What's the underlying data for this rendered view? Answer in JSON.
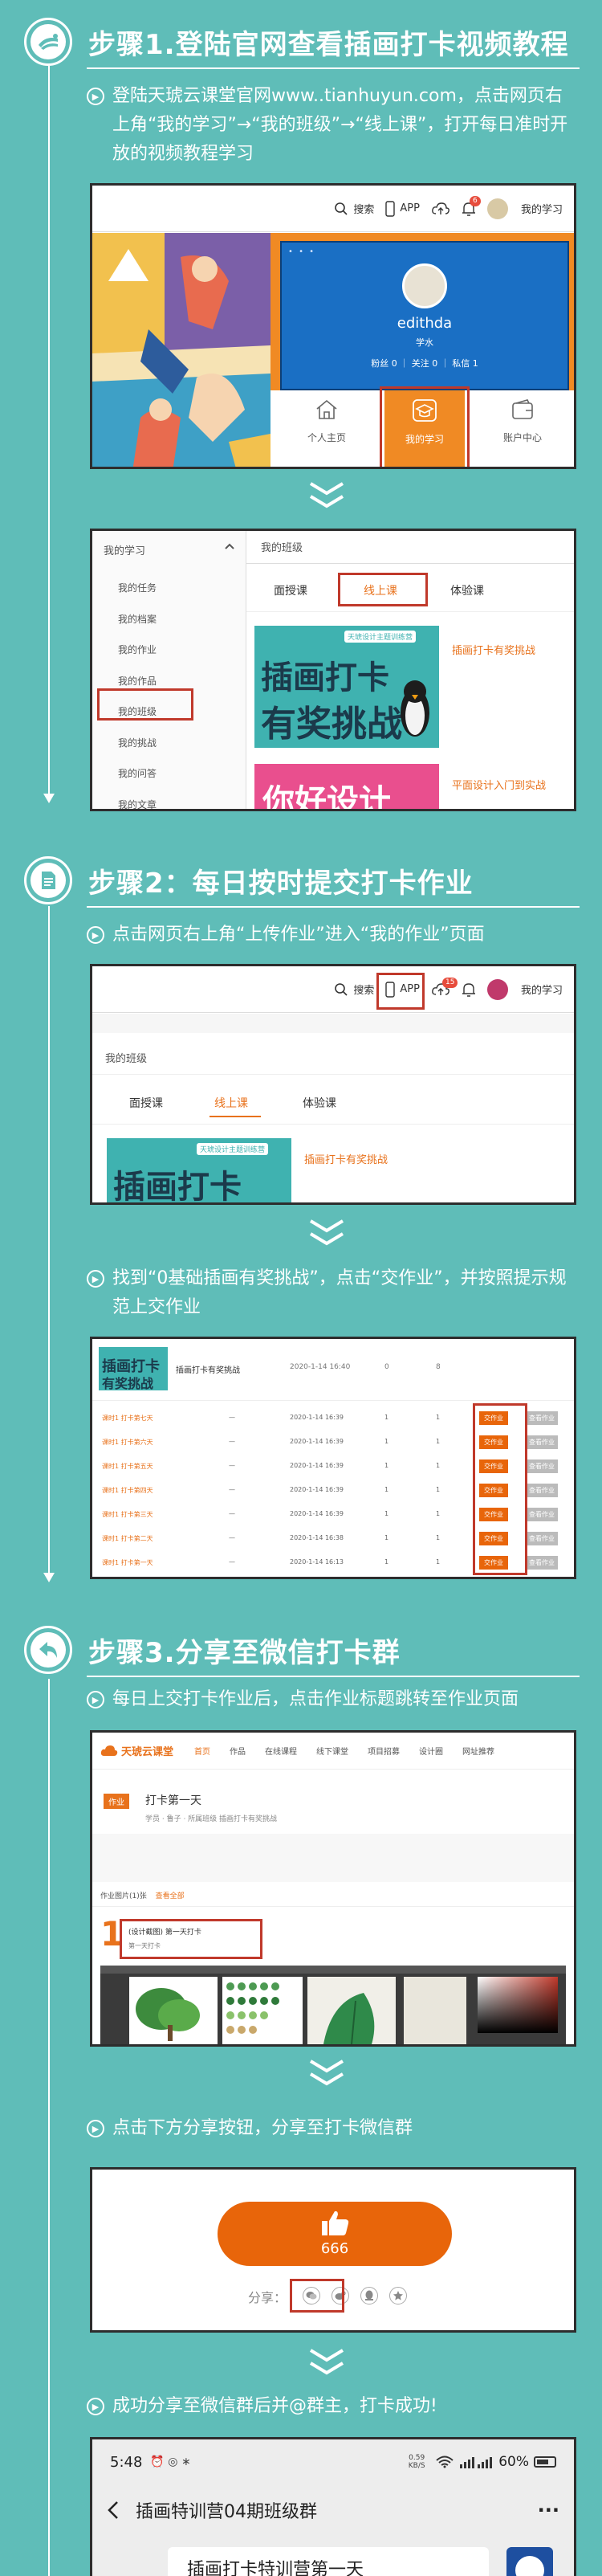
{
  "step1": {
    "title": "步骤1.登陆官网查看插画打卡视频教程",
    "bullet": "登陆天琥云课堂官网www..tianhuyun.com，点击网页右上角“我的学习”→“我的班级”→“线上课”，打开每日准时开放的视频教程学习",
    "shot1": {
      "search": "搜索",
      "app": "APP",
      "badge": "6",
      "my_learning": "我的学习",
      "username": "edithda",
      "role": "学水",
      "stats": "粉丝 0 ｜ 关注 0 ｜ 私信 1",
      "tab_home": "个人主页",
      "tab_learning": "我的学习",
      "tab_account": "账户中心"
    },
    "shot2": {
      "menu_header": "我的学习",
      "menu": [
        "我的任务",
        "我的档案",
        "我的作业",
        "我的作品",
        "我的班级",
        "我的挑战",
        "我的问答",
        "我的文章"
      ],
      "class_title": "我的班级",
      "tabs": [
        "面授课",
        "线上课",
        "体验课"
      ],
      "course1_title": "插画打卡有奖挑战",
      "course1_banner": "插画打卡",
      "course1_banner2": "有奖挑战",
      "course1_tag": "天琥设计主题训练营",
      "course2_title": "平面设计入门到实战",
      "course2_banner": "你好设计"
    }
  },
  "step2": {
    "title": "步骤2：每日按时提交打卡作业",
    "bullet1": "点击网页右上角“上传作业”进入“我的作业”页面",
    "shot3": {
      "search": "搜索",
      "app": "APP",
      "badge": "15",
      "my_learning": "我的学习",
      "class_title": "我的班级",
      "tabs": [
        "面授课",
        "线上课",
        "体验课"
      ],
      "course_title": "插画打卡有奖挑战",
      "course_banner": "插画打卡",
      "course_tag": "天琥设计主题训练营"
    },
    "bullet2": "找到“0基础插画有奖挑战”，点击“交作业”，并按照提示规范上交作业",
    "shot4": {
      "course_title": "插画打卡有奖挑战",
      "header_date": "2020-1-14 16:40",
      "header_n1": "0",
      "header_n2": "8",
      "rows": [
        {
          "name": "课时1 打卡第七天",
          "date": "2020-1-14 16:39"
        },
        {
          "name": "课时1 打卡第六天",
          "date": "2020-1-14 16:39"
        },
        {
          "name": "课时1 打卡第五天",
          "date": "2020-1-14 16:39"
        },
        {
          "name": "课时1 打卡第四天",
          "date": "2020-1-14 16:39"
        },
        {
          "name": "课时1 打卡第三天",
          "date": "2020-1-14 16:39"
        },
        {
          "name": "课时1 打卡第二天",
          "date": "2020-1-14 16:38"
        },
        {
          "name": "课时1 打卡第一天",
          "date": "2020-1-14 16:13"
        }
      ],
      "dash": "—",
      "one": "1",
      "btn_submit": "交作业",
      "btn_other": "查看作业"
    }
  },
  "step3": {
    "title": "步骤3.分享至微信打卡群",
    "bullet1": "每日上交打卡作业后，点击作业标题跳转至作业页面",
    "shot5": {
      "logo": "天琥云课堂",
      "nav": [
        "首页",
        "作品",
        "在线课程",
        "线下课堂",
        "项目招募",
        "设计圈",
        "网址推荐"
      ],
      "tag": "作业",
      "work_title": "打卡第一天",
      "meta": "学员  ·  鲁子  ·  所属班级 插画打卡有奖挑战",
      "count_label": "作业图片(1)张",
      "count_link": "查看全部",
      "big_num": "1",
      "item_title": "(设计截图) 第一天打卡",
      "item_sub": "第一天打卡"
    },
    "bullet2": "点击下方分享按钮，分享至打卡微信群",
    "shot6": {
      "likes": "666",
      "share_label": "分享："
    },
    "bullet3": "成功分享至微信群后并@群主，打卡成功!",
    "shot7": {
      "time": "5:48",
      "net": "0.59 KB/S",
      "battery": "60%",
      "chat_title": "插画特训营04期班级群",
      "more": "···",
      "preview": "插画打卡特训营第一天"
    }
  }
}
